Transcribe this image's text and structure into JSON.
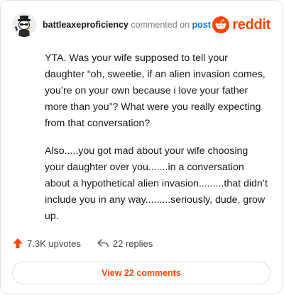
{
  "comment": {
    "username": "battleaxeproficiency",
    "action_text": "commented on",
    "post_link": "post",
    "brand": "reddit",
    "paragraphs": [
      "YTA. Was your wife supposed to tell your daughter “oh, sweetie, if an alien invasion comes, you’re on your own because i love your father more than you”? What were you really expecting from that conversation?",
      "Also.....you got mad about your wife choosing your daughter over you.......in a conversation about a hypothetical alien invasion.........that didn’t include you in any way.........seriously, dude, grow up."
    ],
    "upvotes": "7.3K upvotes",
    "replies": "22 replies",
    "view_comments": "View 22 comments"
  },
  "colors": {
    "accent": "#ff4500",
    "link": "#0079d3",
    "muted": "#7c7c7c"
  },
  "icons": {
    "avatar": "snoo-avatar",
    "brand": "reddit-logo-icon",
    "upvote": "upvote-arrow-icon",
    "reply": "reply-arrow-icon"
  }
}
